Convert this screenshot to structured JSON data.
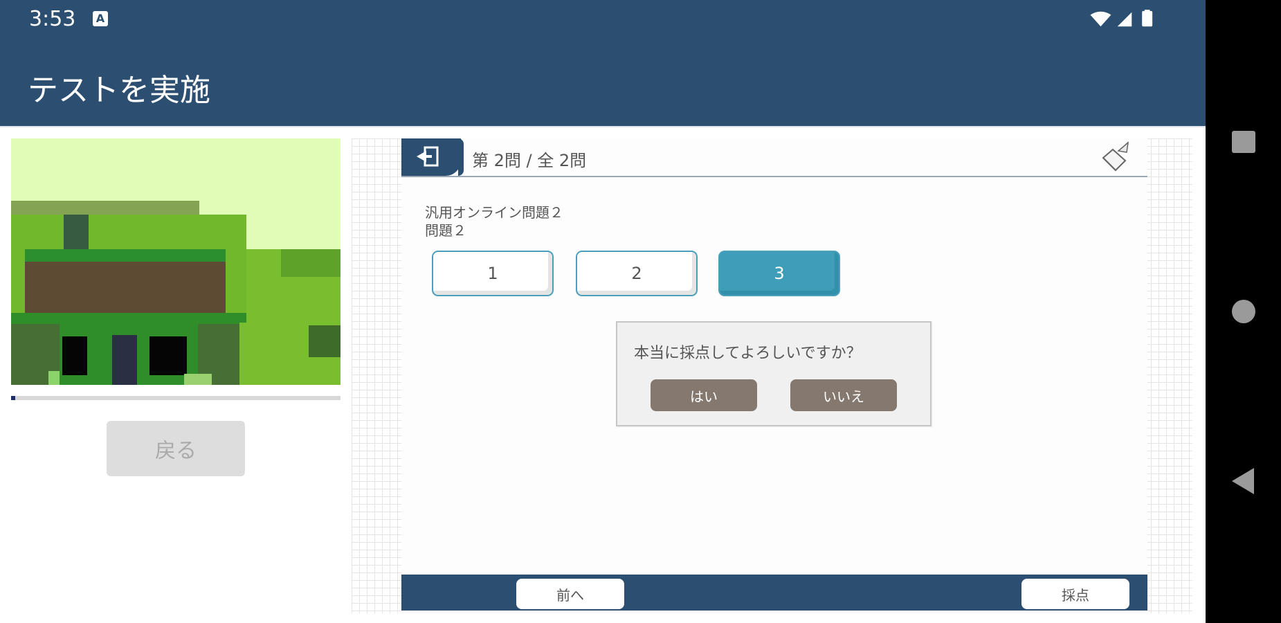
{
  "status_bar": {
    "time": "3:53",
    "notification_icon": "a-icon"
  },
  "app_bar": {
    "title": "テストを実施"
  },
  "left_panel": {
    "back_label": "戻る",
    "progress_fraction": 0.01
  },
  "test": {
    "question_counter": "第 2問 / 全 2問",
    "question_title": "汎用オンライン問題２",
    "question_sub": "問題２",
    "choices": [
      {
        "label": "1",
        "selected": false
      },
      {
        "label": "2",
        "selected": false
      },
      {
        "label": "3",
        "selected": true
      }
    ],
    "confirm_dialog": {
      "message": "本当に採点してよろしいですか？",
      "yes": "はい",
      "no": "いいえ"
    },
    "footer": {
      "prev": "前へ",
      "score": "採点"
    }
  },
  "colors": {
    "primary": "#2c4f71",
    "accent": "#3e9db8",
    "dialog_button": "#85796f",
    "navbar": "#000000"
  },
  "nav": {
    "icons": [
      "recent-apps-icon",
      "home-icon",
      "back-icon"
    ]
  }
}
